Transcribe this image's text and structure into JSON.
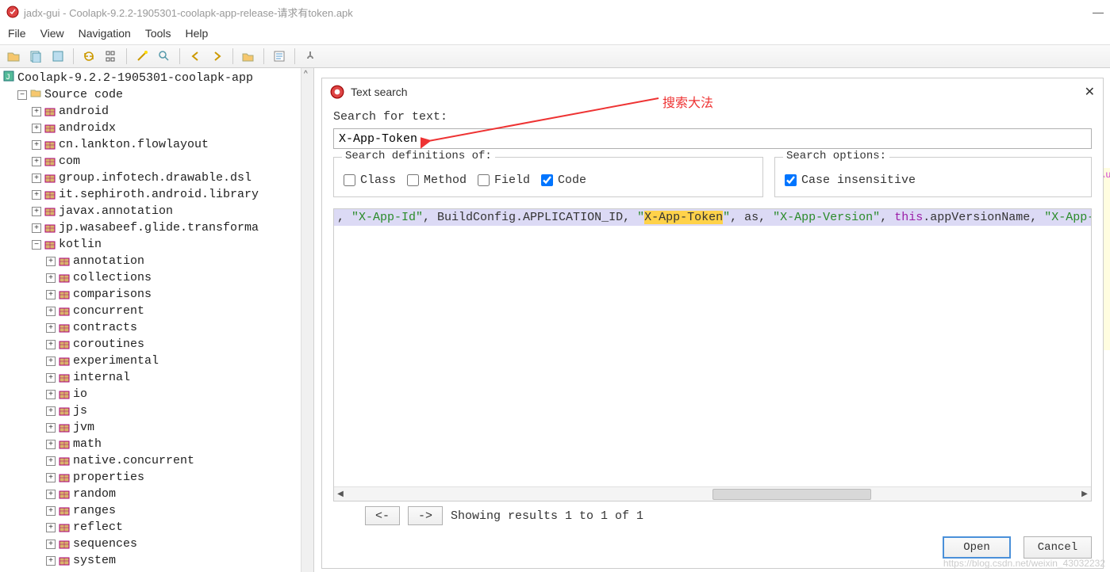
{
  "window": {
    "title": "jadx-gui - Coolapk-9.2.2-1905301-coolapk-app-release-请求有token.apk",
    "minimize": "—"
  },
  "menu": {
    "file": "File",
    "view": "View",
    "navigation": "Navigation",
    "tools": "Tools",
    "help": "Help"
  },
  "tree": {
    "root": "Coolapk-9.2.2-1905301-coolapk-app",
    "source": "Source code",
    "pkgs": [
      "android",
      "androidx",
      "cn.lankton.flowlayout",
      "com",
      "group.infotech.drawable.dsl",
      "it.sephiroth.android.library",
      "javax.annotation",
      "jp.wasabeef.glide.transforma"
    ],
    "kotlin": "kotlin",
    "kotlin_children": [
      "annotation",
      "collections",
      "comparisons",
      "concurrent",
      "contracts",
      "coroutines",
      "experimental",
      "internal",
      "io",
      "js",
      "jvm",
      "math",
      "native.concurrent",
      "properties",
      "random",
      "ranges",
      "reflect",
      "sequences",
      "system"
    ]
  },
  "dialog": {
    "title": "Text search",
    "close_x": "✕",
    "search_label": "Search for text:",
    "search_value": "X-App-Token",
    "defs_legend": "Search definitions of:",
    "chk_class": "Class",
    "chk_method": "Method",
    "chk_field": "Field",
    "chk_code": "Code",
    "opts_legend": "Search options:",
    "chk_case": "Case insensitive",
    "result_p1": ", ",
    "result_s1": "\"X-App-Id\"",
    "result_p2": ", BuildConfig.APPLICATION_ID, ",
    "result_s2a": "\"",
    "result_hl": "X-App-Token",
    "result_s2b": "\"",
    "result_p3": ", as, ",
    "result_s3": "\"X-App-Version\"",
    "result_p4": ", ",
    "result_kthis": "this",
    "result_p5": ".appVersionName, ",
    "result_s4": "\"X-App-C",
    "nav_prev": "<-",
    "nav_next": "->",
    "status": "Showing results 1 to 1 of 1",
    "open": "Open",
    "cancel": "Cancel"
  },
  "annotation": {
    "text": "搜索大法"
  },
  "rightedge": {
    "txt": "\\u"
  },
  "watermark": "https://blog.csdn.net/weixin_43032232"
}
